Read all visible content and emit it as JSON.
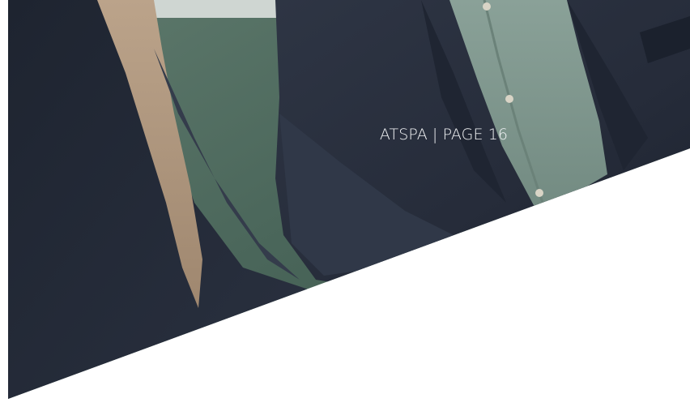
{
  "document": {
    "footer_label": "ATSPA | PAGE 16"
  },
  "colors": {
    "jacket_navy": "#262d3a",
    "shirt_denim": "#7f988f",
    "background_green": "#4d6a5c",
    "skin_tan": "#b39a82",
    "page_white": "#ffffff",
    "label_text": "#f2f4f6"
  }
}
